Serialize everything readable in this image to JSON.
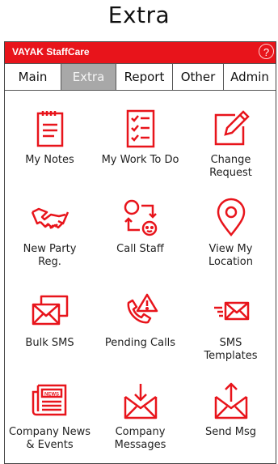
{
  "page": {
    "title": "Extra"
  },
  "app": {
    "name": "VAYAK StaffCare",
    "help_glyph": "?"
  },
  "tabs": [
    {
      "label": "Main",
      "active": false
    },
    {
      "label": "Extra",
      "active": true
    },
    {
      "label": "Report",
      "active": false
    },
    {
      "label": "Other",
      "active": false
    },
    {
      "label": "Admin",
      "active": false
    }
  ],
  "colors": {
    "accent": "#e8141b",
    "active_tab": "#a8a8a8"
  },
  "items": [
    {
      "label": "My Notes",
      "icon": "notepad-icon"
    },
    {
      "label": "My Work To Do",
      "icon": "checklist-icon"
    },
    {
      "label": "Change Request",
      "icon": "edit-icon"
    },
    {
      "label": "New Party Reg.",
      "icon": "handshake-icon"
    },
    {
      "label": "Call Staff",
      "icon": "call-staff-icon"
    },
    {
      "label": "View My Location",
      "icon": "location-pin-icon"
    },
    {
      "label": "Bulk SMS",
      "icon": "envelopes-icon"
    },
    {
      "label": "Pending Calls",
      "icon": "phone-alert-icon"
    },
    {
      "label": "SMS Templates",
      "icon": "fast-mail-icon"
    },
    {
      "label": "Company News & Events",
      "icon": "newspaper-icon"
    },
    {
      "label": "Company Messages",
      "icon": "inbox-icon"
    },
    {
      "label": "Send Msg",
      "icon": "send-mail-icon"
    }
  ]
}
